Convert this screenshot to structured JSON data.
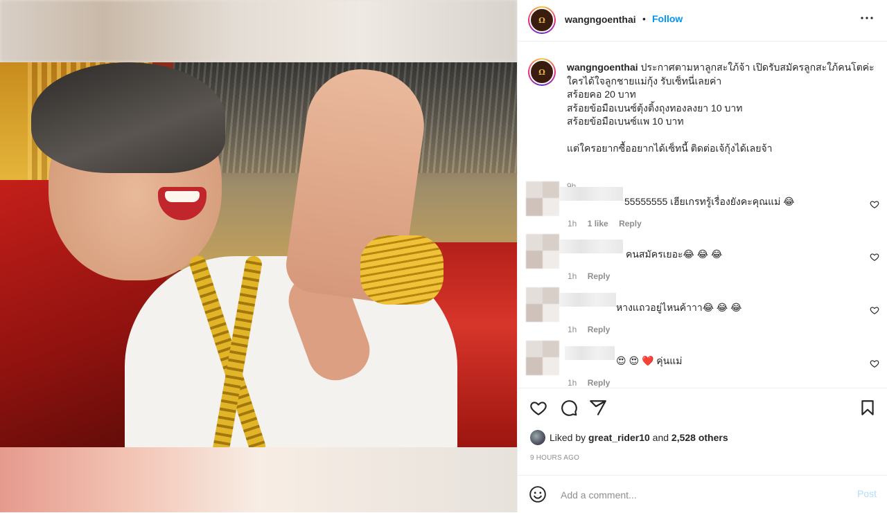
{
  "post": {
    "username": "wangngoenthai",
    "dot": "•",
    "follow_label": "Follow",
    "more_label": "•••",
    "avatar_text": "Ω"
  },
  "caption": {
    "username": "wangngoenthai",
    "text": "ประกาศตามหาลูกสะใภ้จ้า เปิดรับสมัครลูกสะใภ้คนโตค่ะ ใครได้ใจลูกชายแม่กุ้ง รับเซ็ทนี่เลยค่า\nสร้อยคอ 20 บาท\nสร้อยข้อมือเบนซ์ตุ้งติ้งถุงทองลงยา 10 บาท\nสร้อยข้อมือเบนซ์แพ 10 บาท\n\nแต่ใครอยากซื้ออยากได้เซ็ทนี้ ติดต่อเจ้กุ้งได้เลยจ้า",
    "time": "9h"
  },
  "comments": [
    {
      "text": "55555555 เฮียเกรทรู้เรื่องยังคะคุณแม่ 😂",
      "time": "1h",
      "likes": "1 like",
      "reply": "Reply"
    },
    {
      "text": "คนสมัครเยอะ😂 😂 😂",
      "time": "1h",
      "reply": "Reply"
    },
    {
      "text": "หางแถวอยู่ไหนค้าาา😂 😂 😂",
      "time": "1h",
      "reply": "Reply"
    },
    {
      "text": "😍 😍 ❤️ คุ่นแม่",
      "time": "1h",
      "reply": "Reply"
    }
  ],
  "likes": {
    "prefix": "Liked by",
    "user": "great_rider10",
    "and": "and",
    "others": "2,528 others"
  },
  "timestamp": "9 HOURS AGO",
  "add_comment": {
    "placeholder": "Add a comment...",
    "post_label": "Post"
  },
  "colors": {
    "accent": "#0095f6",
    "post_disabled": "#b3dbff",
    "muted": "#8e8e8e"
  }
}
